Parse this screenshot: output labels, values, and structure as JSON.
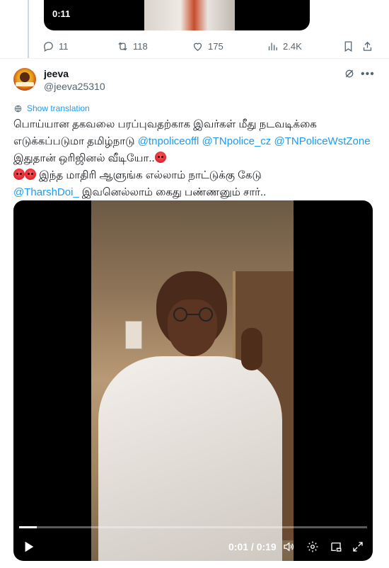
{
  "previous_post": {
    "video_duration": "0:11",
    "actions": {
      "replies": "11",
      "reposts": "118",
      "likes": "175",
      "views": "2.4K"
    }
  },
  "post": {
    "author_name": "jeeva",
    "author_handle": "@jeeva25310",
    "show_translation": "Show translation",
    "text_parts": {
      "p1": "பொய்யான தகவலை பரப்புவதற்காக இவர்கள் மீது நடவடிக்கை எடுக்கப்படுமா தமிழ்நாடு ",
      "m1": "@tnpoliceoffl",
      "m2": "@TNpolice_cz",
      "m3": "@TNPoliceWstZone",
      "p2": " இதுதான் ஒரிஜினல் வீடியோ..",
      "p3": " இந்த மாதிரி ஆளுங்க எல்லாம் நாட்டுக்கு கேடு",
      "m4": "@TharshDoi_",
      "p4": " இவனெல்லாம் கைது பண்ணனும் சார்.."
    },
    "video": {
      "time": "0:01 / 0:19",
      "progress": 0.05
    }
  },
  "colors": {
    "link": "#1d9bf0",
    "secondary_text": "#536471",
    "primary_text": "#0f1419"
  },
  "icons": [
    "reply-icon",
    "repost-icon",
    "like-icon",
    "views-icon",
    "bookmark-icon",
    "share-icon",
    "grok-icon",
    "more-icon",
    "globe-icon",
    "play-icon",
    "volume-icon",
    "settings-icon",
    "pip-icon",
    "fullscreen-icon"
  ]
}
